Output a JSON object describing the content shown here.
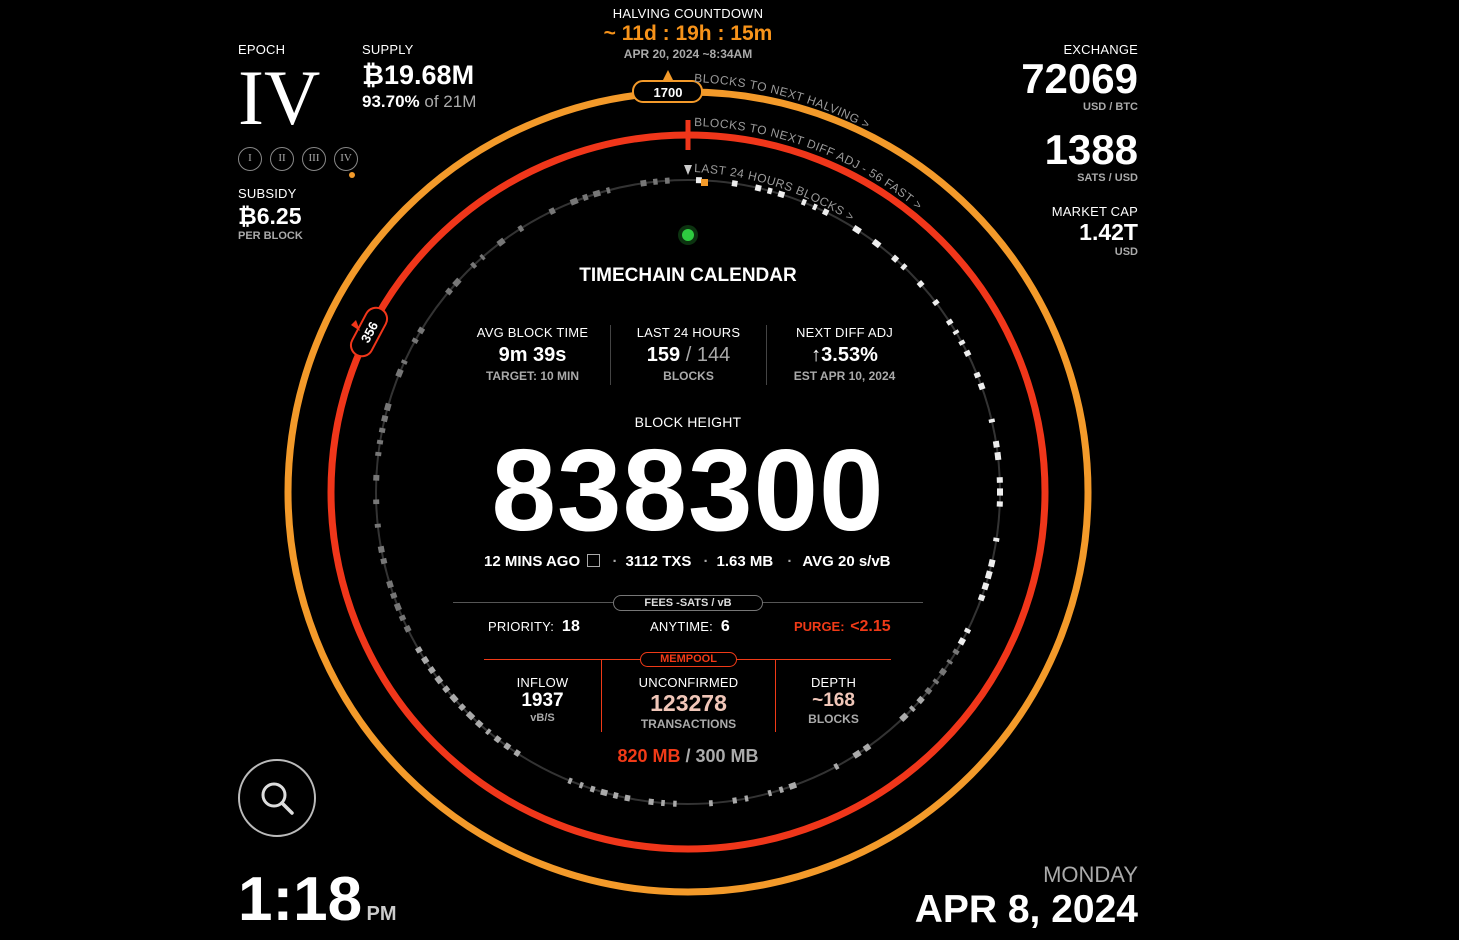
{
  "halving": {
    "title": "HALVING COUNTDOWN",
    "countdown": "~ 11d : 19h : 15m",
    "date": "APR 20, 2024 ~8:34AM",
    "blocks_remaining": "1700",
    "blocks_label": "BLOCKS TO NEXT HALVING >"
  },
  "diff_adj_label": "BLOCKS TO NEXT DIFF ADJ - 56 FAST >",
  "last24_label": "LAST 24 HOURS BLOCKS >",
  "diff_marker": "356",
  "epoch": {
    "label": "EPOCH",
    "value": "IV",
    "pills": [
      "I",
      "II",
      "III",
      "IV"
    ]
  },
  "supply": {
    "label": "SUPPLY",
    "value": "₿19.68M",
    "pct": "93.70%",
    "of": "of 21M"
  },
  "subsidy": {
    "label": "SUBSIDY",
    "value": "₿6.25",
    "unit": "PER BLOCK"
  },
  "exchange": {
    "label": "EXCHANGE",
    "value": "72069",
    "unit": "USD / BTC"
  },
  "sats": {
    "value": "1388",
    "unit": "SATS / USD"
  },
  "market_cap": {
    "label": "MARKET CAP",
    "value": "1.42T",
    "unit": "USD"
  },
  "center": {
    "title": "TIMECHAIN CALENDAR",
    "stats": [
      {
        "label": "AVG BLOCK TIME",
        "value": "9m 39s",
        "sub": "TARGET: 10 MIN"
      },
      {
        "label": "LAST 24 HOURS",
        "value": "159",
        "value2": "/ 144",
        "sub": "BLOCKS"
      },
      {
        "label": "NEXT DIFF ADJ",
        "value": "↑3.53%",
        "sub": "EST APR 10, 2024"
      }
    ],
    "height_label": "BLOCK HEIGHT",
    "height": "838300",
    "meta": {
      "ago": "12 MINS AGO",
      "txs": "3112 TXS",
      "size": "1.63 MB",
      "avg": "AVG 20 s/vB"
    },
    "fees_pill": "FEES -SATS / vB",
    "fees": {
      "priority_label": "PRIORITY:",
      "priority": "18",
      "anytime_label": "ANYTIME:",
      "anytime": "6",
      "purge_label": "PURGE:",
      "purge": "<2.15"
    },
    "mempool_pill": "MEMPOOL",
    "mempool": [
      {
        "label": "INFLOW",
        "value": "1937",
        "sub": "vB/S"
      },
      {
        "label": "UNCONFIRMED",
        "value": "123278",
        "sub": "TRANSACTIONS"
      },
      {
        "label": "DEPTH",
        "value": "~168",
        "sub": "BLOCKS"
      }
    ],
    "mem_used": "820 MB",
    "mem_max": "/ 300 MB"
  },
  "clock": {
    "time": "1:18",
    "ampm": "PM"
  },
  "date": {
    "weekday": "MONDAY",
    "full": "APR 8, 2024"
  },
  "colors": {
    "orange": "#f7931a",
    "red": "#f03a17",
    "green": "#2ecc40"
  }
}
